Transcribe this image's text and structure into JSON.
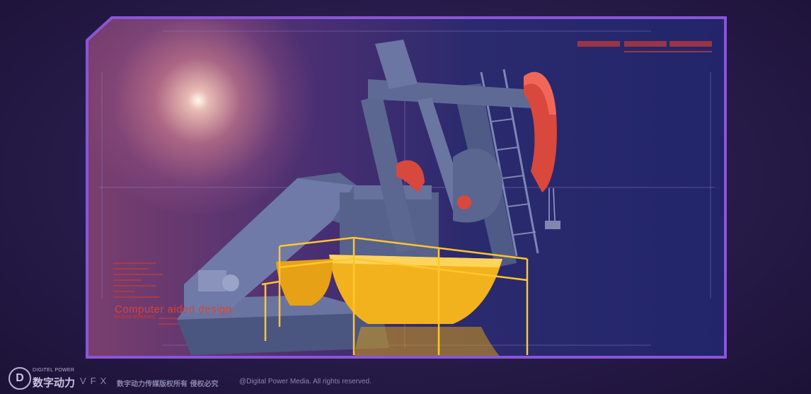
{
  "overlay": {
    "title": "Computer aided design",
    "subtitle": "NAGUA DYNAMIC"
  },
  "footer": {
    "logo_letter": "D",
    "brand_en": "DIGITEL POWER",
    "brand_cn": "数字动力",
    "vfx": "VFX",
    "copyright_cn": "数字动力传媒版权所有 侵权必究",
    "copyright_en": "@Digital Power Media. All rights reserved."
  },
  "colors": {
    "frame": "#8a55d8",
    "hud_red": "#e0402e",
    "pump_yellow": "#f2b21e",
    "pump_red": "#d9483c",
    "pump_steel": "#5b6790"
  },
  "icons": [
    "digital-power-logo-icon",
    "pump-jack-illustration",
    "sun-glow",
    "crosshair",
    "ruler-ticks"
  ]
}
